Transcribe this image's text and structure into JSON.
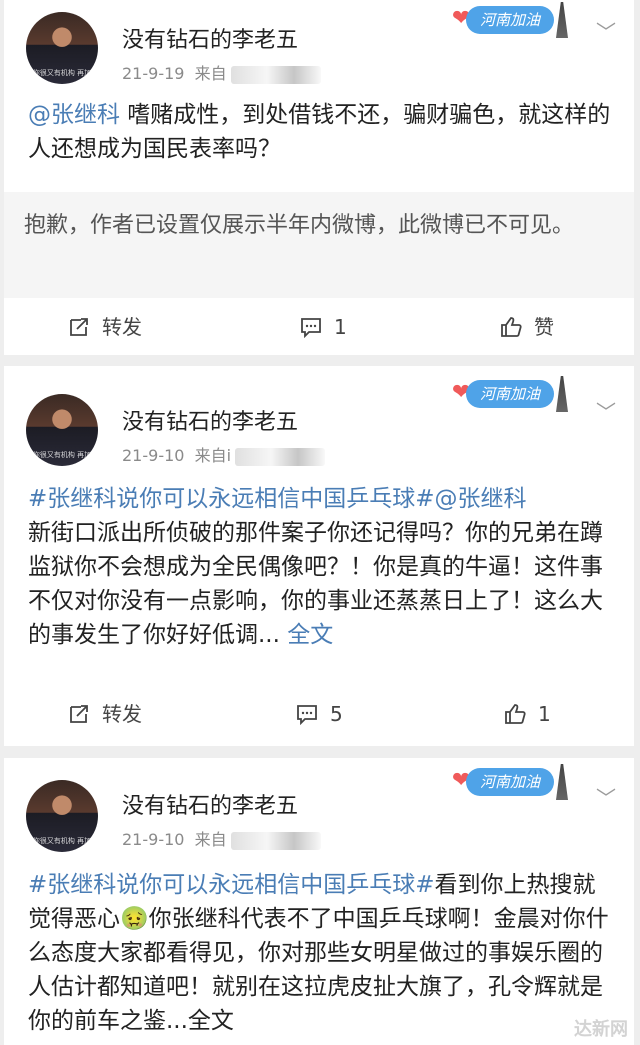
{
  "posts": [
    {
      "username": "没有钻石的李老五",
      "date": "21-9-19",
      "source": "来自",
      "avatar_caption": "你很又有机构 再加",
      "badge_label": "河南加油",
      "mention": "@张继科",
      "body": " 嗜赌成性，到处借钱不还，骗财骗色，就这样的人还想成为国民表率吗？",
      "notice": "抱歉，作者已设置仅展示半年内微博，此微博已不可见。",
      "repost_label": "转发",
      "comment_count": "1",
      "like_label": "赞"
    },
    {
      "username": "没有钻石的李老五",
      "date": "21-9-10",
      "source": "来自i",
      "avatar_caption": "你很又有机构 再加",
      "badge_label": "河南加油",
      "hashtag": "#张继科说你可以永远相信中国乒乓球#",
      "mention": "@张继科",
      "body": "新街口派出所侦破的那件案子你还记得吗？你的兄弟在蹲监狱你不会想成为全民偶像吧？！你是真的牛逼！这件事不仅对你没有一点影响，你的事业还蒸蒸日上了！这么大的事发生了你好好低调...",
      "fulltext": " 全文",
      "repost_label": "转发",
      "comment_count": "5",
      "like_count": "1"
    },
    {
      "username": "没有钻石的李老五",
      "date": "21-9-10",
      "source": "来自",
      "avatar_caption": "你很又有机构 再加",
      "badge_label": "河南加油",
      "hashtag": "#张继科说你可以永远相信中国乒乓球#",
      "body": "看到你上热搜就觉得恶心🤢你张继科代表不了中国乒乓球啊！金晨对你什么态度大家都看得见，你对那些女明星做过的事娱乐圈的人估计都知道吧！就别在这拉虎皮扯大旗了，孔令辉就是你的前车之鉴...全文"
    }
  ],
  "watermark": "达新网"
}
